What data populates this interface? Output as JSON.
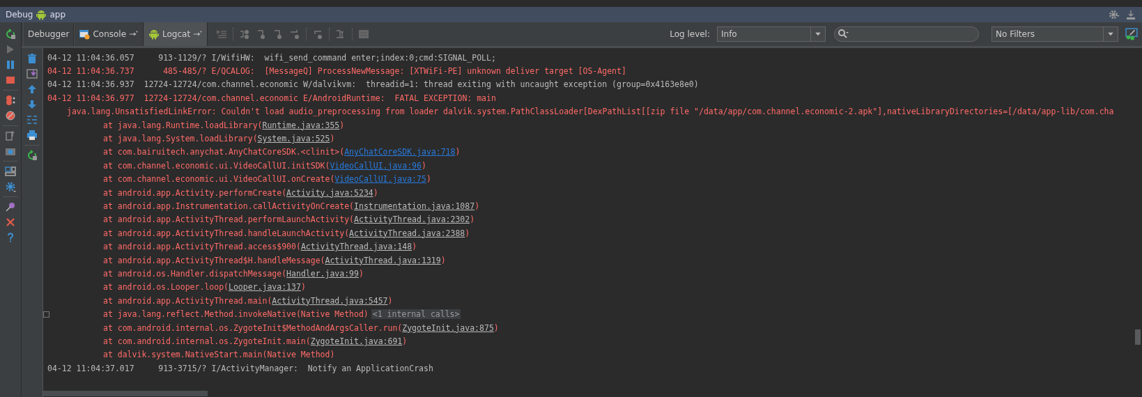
{
  "window": {
    "title": "Debug",
    "config": "app"
  },
  "tabs": [
    {
      "kind": "debugger",
      "label": "Debugger",
      "selected": false
    },
    {
      "kind": "console",
      "label": "Console",
      "selected": false
    },
    {
      "kind": "logcat",
      "label": "Logcat",
      "selected": true
    }
  ],
  "log_level": {
    "label": "Log level:",
    "value": "Info"
  },
  "filter": {
    "value": "No Filters"
  },
  "log": [
    {
      "kind": "info",
      "text": "04-12 11:04:36.057     913-1129/? I/WifiHW:  wifi_send_command enter;index:0;cmd:SIGNAL_POLL;"
    },
    {
      "kind": "error",
      "text": "04-12 11:04:36.737      485-485/? E/QCALOG:  [MessageQ] ProcessNewMessage: [XTWiFi-PE] unknown deliver target [OS-Agent]"
    },
    {
      "kind": "info",
      "text": "04-12 11:04:36.937  12724-12724/com.channel.economic W/dalvikvm:  threadid=1: thread exiting with uncaught exception (group=0x4163e8e0)"
    },
    {
      "kind": "error",
      "text": "04-12 11:04:36.977  12724-12724/com.channel.economic E/AndroidRuntime:  FATAL EXCEPTION: main"
    },
    {
      "kind": "exception",
      "text": "java.lang.UnsatisfiedLinkError: Couldn't load audio_preprocessing from loader dalvik.system.PathClassLoader[DexPathList[[zip file \"/data/app/com.channel.economic-2.apk\"],nativeLibraryDirectories=[/data/app-lib/com.cha"
    },
    {
      "kind": "frame",
      "text": "at java.lang.Runtime.loadLibrary(",
      "link": "Runtime.java:355",
      "after": ")",
      "in_project": false
    },
    {
      "kind": "frame",
      "text": "at java.lang.System.loadLibrary(",
      "link": "System.java:525",
      "after": ")",
      "in_project": false
    },
    {
      "kind": "frame",
      "text": "at com.bairuitech.anychat.AnyChatCoreSDK.<clinit>(",
      "link": "AnyChatCoreSDK.java:718",
      "after": ")",
      "in_project": true
    },
    {
      "kind": "frame",
      "text": "at com.channel.economic.ui.VideoCallUI.initSDK(",
      "link": "VideoCallUI.java:96",
      "after": ")",
      "in_project": true
    },
    {
      "kind": "frame",
      "text": "at com.channel.economic.ui.VideoCallUI.onCreate(",
      "link": "VideoCallUI.java:75",
      "after": ")",
      "in_project": true
    },
    {
      "kind": "frame",
      "text": "at android.app.Activity.performCreate(",
      "link": "Activity.java:5234",
      "after": ")",
      "in_project": false
    },
    {
      "kind": "frame",
      "text": "at android.app.Instrumentation.callActivityOnCreate(",
      "link": "Instrumentation.java:1087",
      "after": ")",
      "in_project": false
    },
    {
      "kind": "frame",
      "text": "at android.app.ActivityThread.performLaunchActivity(",
      "link": "ActivityThread.java:2302",
      "after": ")",
      "in_project": false
    },
    {
      "kind": "frame",
      "text": "at android.app.ActivityThread.handleLaunchActivity(",
      "link": "ActivityThread.java:2388",
      "after": ")",
      "in_project": false
    },
    {
      "kind": "frame",
      "text": "at android.app.ActivityThread.access$900(",
      "link": "ActivityThread.java:148",
      "after": ")",
      "in_project": false
    },
    {
      "kind": "frame",
      "text": "at android.app.ActivityThread$H.handleMessage(",
      "link": "ActivityThread.java:1319",
      "after": ")",
      "in_project": false
    },
    {
      "kind": "frame",
      "text": "at android.os.Handler.dispatchMessage(",
      "link": "Handler.java:99",
      "after": ")",
      "in_project": false
    },
    {
      "kind": "frame",
      "text": "at android.os.Looper.loop(",
      "link": "Looper.java:137",
      "after": ")",
      "in_project": false
    },
    {
      "kind": "frame",
      "text": "at android.app.ActivityThread.main(",
      "link": "ActivityThread.java:5457",
      "after": ")",
      "in_project": false
    },
    {
      "kind": "frame",
      "text": "at java.lang.reflect.Method.invokeNative(Native Method)",
      "folded": "<1 internal calls>"
    },
    {
      "kind": "frame",
      "text": "at com.android.internal.os.ZygoteInit$MethodAndArgsCaller.run(",
      "link": "ZygoteInit.java:875",
      "after": ")",
      "in_project": false
    },
    {
      "kind": "frame",
      "text": "at com.android.internal.os.ZygoteInit.main(",
      "link": "ZygoteInit.java:691",
      "after": ")",
      "in_project": false
    },
    {
      "kind": "frame",
      "text": "at dalvik.system.NativeStart.main(Native Method)"
    },
    {
      "kind": "info",
      "text": "04-12 11:04:37.017     913-3715/? I/ActivityManager:  Notify an ApplicationCrash"
    }
  ]
}
